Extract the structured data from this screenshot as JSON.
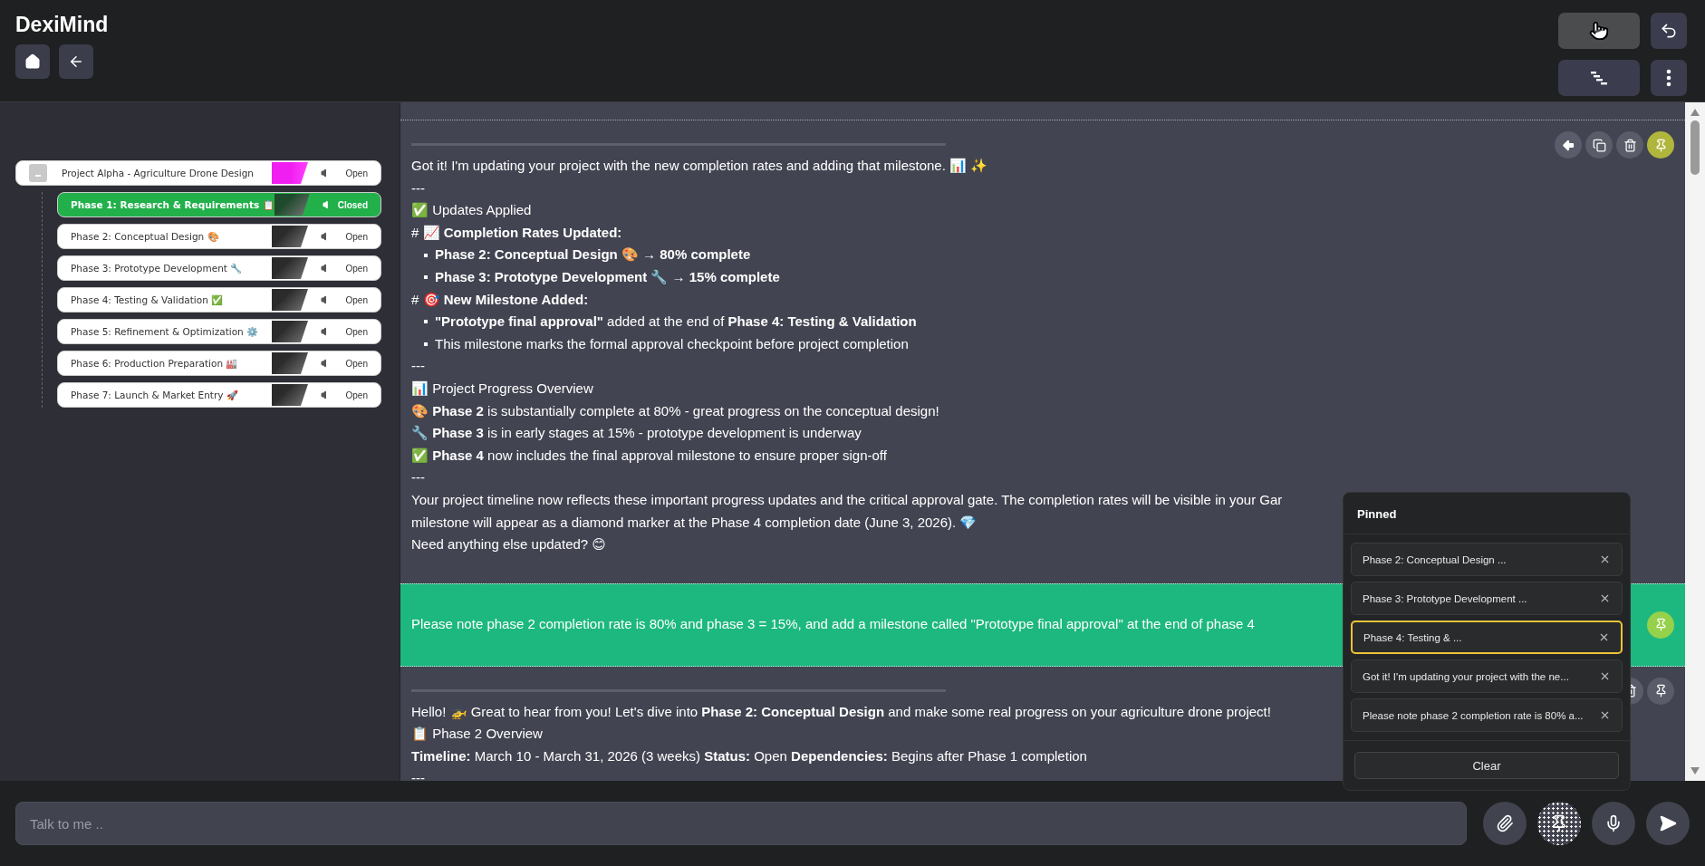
{
  "app": {
    "title": "DexiMind"
  },
  "tree": {
    "label": "Project Alpha - Agriculture Drone Design",
    "status": "Open",
    "color": "#f01ef0",
    "expanded": true,
    "selected": false,
    "children": [
      {
        "label": "Phase 1: Research & Requirements 📋",
        "status": "Closed",
        "color": "#1f4a2c",
        "selected": true
      },
      {
        "label": "Phase 2: Conceptual Design 🎨",
        "status": "Open",
        "color": "#2b2b2b",
        "selected": false
      },
      {
        "label": "Phase 3: Prototype Development 🔧",
        "status": "Open",
        "color": "#2b2b2b",
        "selected": false
      },
      {
        "label": "Phase 4: Testing & Validation ✅",
        "status": "Open",
        "color": "#2b2b2b",
        "selected": false
      },
      {
        "label": "Phase 5: Refinement & Optimization ⚙️",
        "status": "Open",
        "color": "#2b2b2b",
        "selected": false
      },
      {
        "label": "Phase 6: Production Preparation 🏭",
        "status": "Open",
        "color": "#2b2b2b",
        "selected": false
      },
      {
        "label": "Phase 7: Launch & Market Entry 🚀",
        "status": "Open",
        "color": "#2b2b2b",
        "selected": false
      }
    ]
  },
  "messages": [
    {
      "kind": "assistant",
      "pinned": true,
      "actions": [
        {
          "kind": "share"
        },
        {
          "kind": "copy"
        },
        {
          "kind": "delete"
        },
        {
          "kind": "pin"
        }
      ],
      "lines": [
        {
          "kind": "text",
          "text": "Got it! I'm updating your project with the new completion rates and adding that milestone. 📊 ✨"
        },
        {
          "kind": "text",
          "text": "---"
        },
        {
          "kind": "text",
          "text": "✅ Updates Applied"
        },
        {
          "kind": "text",
          "text": "# 📈 **Completion Rates Updated:**"
        },
        {
          "kind": "bullet",
          "bold": true,
          "text": "Phase 2: Conceptual Design  🎨 → 80% complete"
        },
        {
          "kind": "bullet",
          "bold": true,
          "text": "Phase 3: Prototype Development  🔧 → 15% complete"
        },
        {
          "kind": "text",
          "text": "# 🎯 **New Milestone Added:**"
        },
        {
          "kind": "bullet",
          "text": "**\"Prototype final approval\"**  added at the end of  **Phase 4: Testing & Validation**"
        },
        {
          "kind": "bullet",
          "text": "This milestone marks the formal approval checkpoint before project completion"
        },
        {
          "kind": "text",
          "text": "---"
        },
        {
          "kind": "text",
          "text": "📊 Project Progress Overview"
        },
        {
          "kind": "text",
          "text": "🎨 **Phase 2** is substantially complete at 80% - great progress on the conceptual design!"
        },
        {
          "kind": "text",
          "text": "🔧 **Phase 3** is in early stages at 15% - prototype development is underway"
        },
        {
          "kind": "text",
          "text": "✅ **Phase 4** now includes the final approval milestone to ensure proper sign-off"
        },
        {
          "kind": "text",
          "text": "---"
        },
        {
          "kind": "text",
          "text": "Your project timeline now reflects these important progress updates and the critical approval gate. The completion rates will be visible in your Gar"
        },
        {
          "kind": "text",
          "text": "milestone will appear as a diamond marker at the Phase 4 completion date (June 3, 2026). 💎"
        },
        {
          "kind": "text",
          "text": "Need anything else updated? 😊"
        }
      ]
    },
    {
      "kind": "user",
      "pinned": true,
      "actions": [
        {
          "kind": "pin"
        }
      ],
      "lines": [
        {
          "kind": "text",
          "text": "Please note phase 2 completion rate is 80% and phase 3 = 15%, and add a milestone called \"Prototype final approval\" at the end of phase 4"
        }
      ]
    },
    {
      "kind": "assistant",
      "pinned": false,
      "actions": [
        {
          "kind": "delete"
        },
        {
          "kind": "pin"
        }
      ],
      "lines": [
        {
          "kind": "text",
          "text": "Hello! 🚁 Great to hear from you! Let's dive into **Phase 2: Conceptual Design** and make some real progress on your agriculture drone project!"
        },
        {
          "kind": "text",
          "text": "📋 Phase 2 Overview"
        },
        {
          "kind": "text",
          "text": "**Timeline:** March 10 - March 31, 2026 (3 weeks) **Status:** Open **Dependencies:** Begins after Phase 1 completion"
        },
        {
          "kind": "text",
          "text": "---"
        }
      ]
    }
  ],
  "pinned_panel": {
    "title": "Pinned",
    "items": [
      {
        "label": "Phase 2: Conceptual Design ...",
        "selected": false
      },
      {
        "label": "Phase 3: Prototype Development ...",
        "selected": false
      },
      {
        "label": "Phase 4: Testing & ...",
        "selected": true
      },
      {
        "label": "Got it! I'm updating your project with the ne...",
        "selected": false
      },
      {
        "label": "Please note phase 2 completion rate is 80% a...",
        "selected": false
      }
    ],
    "clear_button": "Clear"
  },
  "composer": {
    "placeholder": "Talk to me ..",
    "pin_active": true
  }
}
